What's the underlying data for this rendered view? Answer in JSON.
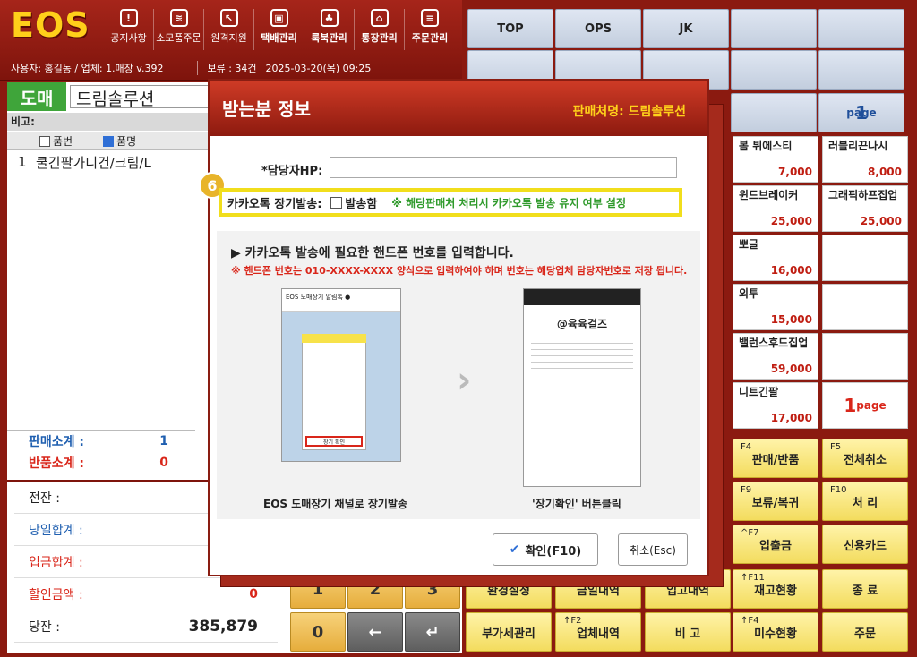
{
  "header": {
    "logo": "EOS",
    "menu": [
      {
        "label": "공지사항",
        "icon": "!",
        "icon_name": "notice-icon"
      },
      {
        "label": "소모품주문",
        "icon": "≋",
        "icon_name": "layers-icon"
      },
      {
        "label": "원격지원",
        "icon": "↖",
        "icon_name": "remote-icon"
      },
      {
        "label": "택배관리",
        "icon": "▣",
        "icon_name": "box-icon"
      },
      {
        "label": "룩북관리",
        "icon": "♣",
        "icon_name": "lookbook-icon"
      },
      {
        "label": "통장관리",
        "icon": "⌂",
        "icon_name": "bank-icon"
      },
      {
        "label": "주문관리",
        "icon": "≡",
        "icon_name": "clipboard-icon"
      }
    ],
    "user_info": "사용자: 홍길동 / 업체: 1.매장 v.392",
    "hold_info": "보류 : 34건",
    "datetime": "2025-03-20(목) 09:25"
  },
  "sale": {
    "mode_label": "도매",
    "customer_name": "드림솔루션",
    "memo_label": "비고:"
  },
  "grid": {
    "col_code": "품번",
    "col_name": "품명",
    "rows": [
      {
        "no": "1",
        "name": "쿨긴팔가디건/크림/L"
      }
    ]
  },
  "subtotals": [
    {
      "label": "판매소계 :",
      "value": "1",
      "label_color": "#1f5fb0",
      "value_color": "#1f5fb0"
    },
    {
      "label": "반품소계 :",
      "value": "0",
      "label_color": "#d9261a",
      "value_color": "#d9261a"
    }
  ],
  "totals": [
    {
      "label": "전잔 :",
      "value": "",
      "color": "#222"
    },
    {
      "label": "당일합계 :",
      "value": "",
      "color": "#1f5fb0"
    },
    {
      "label": "입금합계 :",
      "value": "",
      "color": "#d9261a"
    },
    {
      "label": "할인금액 :",
      "value": "0",
      "color": "#d9261a"
    },
    {
      "label": "당잔 :",
      "value": "385,879",
      "color": "#222"
    }
  ],
  "categories": [
    "TOP",
    "OPS",
    "JK"
  ],
  "pager": {
    "page": "1",
    "unit": "page"
  },
  "products": [
    {
      "name": "봄 뷔에스티",
      "price": "7,000"
    },
    {
      "name": "러블리끈나시",
      "price": "8,000"
    },
    {
      "name": "윈드브레이커",
      "price": "25,000"
    },
    {
      "name": "그래픽하프집업",
      "price": "25,000"
    },
    {
      "name": "뽀글",
      "price": "16,000"
    },
    {
      "name": "외투",
      "price": "15,000"
    },
    {
      "name": "밸런스후드집업",
      "price": "59,000"
    },
    {
      "name": "니트긴팔",
      "price": "17,000"
    }
  ],
  "fkeys": [
    {
      "tag": "F4",
      "label": "판매/반품"
    },
    {
      "tag": "F5",
      "label": "전체취소"
    },
    {
      "tag": "F9",
      "label": "보류/복귀"
    },
    {
      "tag": "F10",
      "label": "처  리"
    },
    {
      "tag": "^F7",
      "label": "입출금"
    },
    {
      "tag": "",
      "label": "신용카드"
    },
    {
      "tag": "",
      "label": "환경설정"
    },
    {
      "tag": "",
      "label": "금일내역"
    },
    {
      "tag": "",
      "label": "입고내역"
    },
    {
      "tag": "↑F11",
      "label": "재고현황"
    },
    {
      "tag": "",
      "label": "종  료"
    },
    {
      "tag": "",
      "label": "부가세관리"
    },
    {
      "tag": "↑F2",
      "label": "업체내역"
    },
    {
      "tag": "",
      "label": "비  고"
    },
    {
      "tag": "↑F4",
      "label": "미수현황"
    },
    {
      "tag": "",
      "label": "주문"
    }
  ],
  "numpad": [
    "1",
    "2",
    "3",
    "0",
    "←",
    "↵"
  ],
  "modal": {
    "title": "받는분 정보",
    "seller": "판매처명: 드림솔루션",
    "hp_label": "*담당자HP:",
    "hp_value": "",
    "step_badge": "6",
    "kakao_label": "카카오톡 장기발송:",
    "kakao_option": "발송함",
    "kakao_note": "※ 해당판매처 처리시 카카오톡 발송 유지 여부 설정",
    "guide_line1": "▶ 카카오톡 발송에 필요한 핸드폰 번호를 입력합니다.",
    "guide_line2": "※ 핸드폰 번호는 010-XXXX-XXXX 양식으로 입력하여야 하며 번호는 해당업체 담당자번호로 저장 됩니다.",
    "phone1_header": "EOS 도매장기 알림톡 ●",
    "phone1_button": "장기 확인",
    "phone2_title": "@육육걸즈",
    "caption1": "EOS 도매장기 채널로 장기발송",
    "caption2": "'장기확인' 버튼클릭",
    "ok_label": "확인(F10)",
    "cancel_label": "취소(Esc)"
  }
}
